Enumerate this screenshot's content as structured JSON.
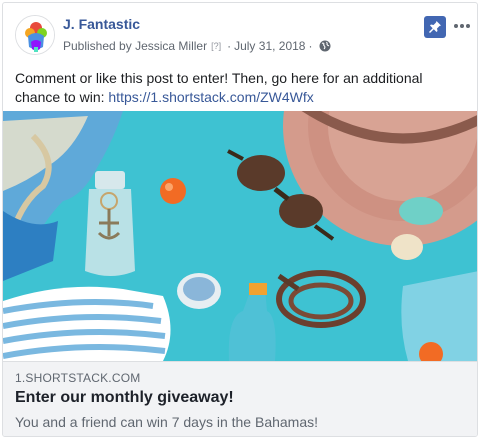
{
  "post": {
    "page_name": "J. Fantastic",
    "published_by_prefix": "Published by",
    "author": "Jessica Miller",
    "author_badge": "[?]",
    "separator": "·",
    "date": "July 31, 2018",
    "privacy_icon": "globe-icon",
    "text_before_link": "Comment or like this post to enter! Then, go here for an additional chance to win: ",
    "link_text": "https://1.shortstack.com/ZW4Wfx"
  },
  "header_actions": {
    "pin_icon": "pin-icon",
    "more_icon": "more-options-icon"
  },
  "link_preview": {
    "domain": "1.SHORTSTACK.COM",
    "title": "Enter our monthly giveaway!",
    "description": "You and a friend can win 7 days in the Bahamas!"
  },
  "colors": {
    "brand_link": "#385898",
    "pin_bg": "#4267b2",
    "footer_bg": "#f2f3f5",
    "photo_background": "#3bbfd0"
  }
}
